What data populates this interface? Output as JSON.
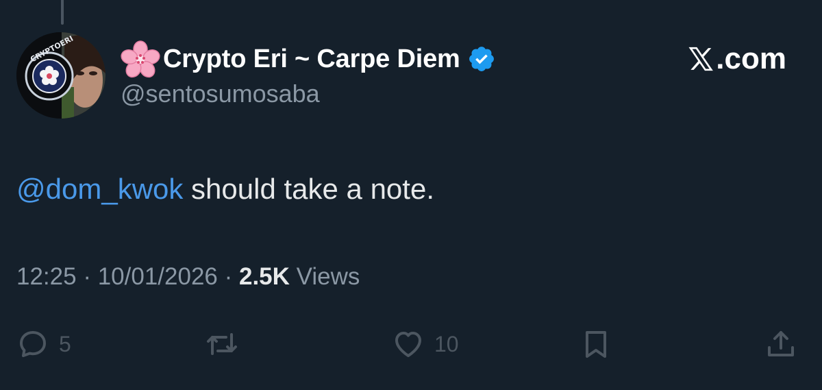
{
  "author": {
    "display_name": "Crypto Eri ~ Carpe Diem",
    "handle": "@sentosumosaba",
    "avatar_text": "CRYPTOERI"
  },
  "brand": {
    "site": ".com"
  },
  "tweet": {
    "mention": "@dom_kwok",
    "text": " should take a note."
  },
  "meta": {
    "time": "12:25",
    "sep1": " · ",
    "date": "10/01/2026",
    "sep2": " · ",
    "views_count": "2.5K",
    "views_label": " Views"
  },
  "actions": {
    "replies": "5",
    "likes": "10"
  },
  "colors": {
    "background": "#15202b",
    "mention": "#4a99e9",
    "verified": "#1d9bf0",
    "secondary": "#8b98a5"
  },
  "icons": [
    "cherry-blossom-icon",
    "verified-badge-icon",
    "x-logo-icon",
    "reply-icon",
    "retweet-icon",
    "like-icon",
    "bookmark-icon",
    "share-icon"
  ]
}
